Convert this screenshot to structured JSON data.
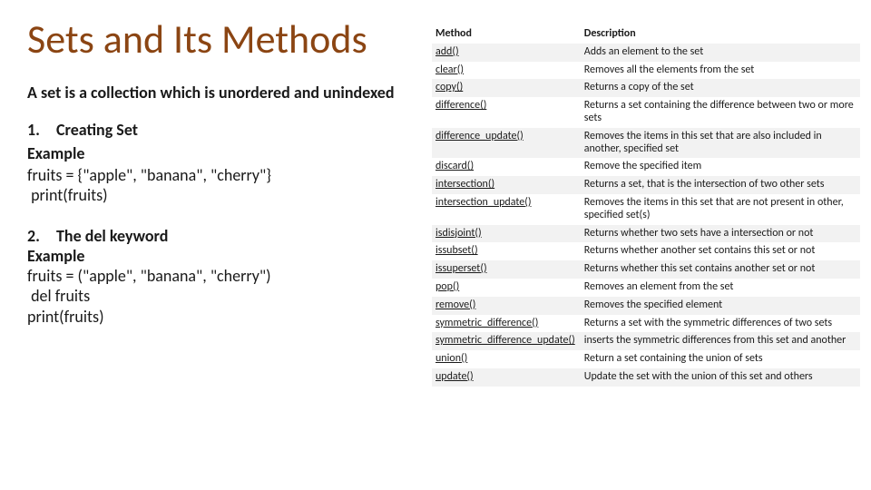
{
  "title": "Sets and Its Methods",
  "subtitle": "A set is a collection which is unordered and unindexed",
  "section1": {
    "num": "1.",
    "heading": "Creating Set",
    "example_label": "Example",
    "code": "fruits = {\"apple\", \"banana\", \"cherry\"}\n print(fruits)"
  },
  "section2": {
    "num": "2.",
    "heading": "The del keyword",
    "example_label": "Example",
    "code": "fruits = (\"apple\", \"banana\", \"cherry\")\n del fruits\nprint(fruits)"
  },
  "table": {
    "headers": {
      "method": "Method",
      "description": "Description"
    },
    "rows": [
      {
        "method": "add()",
        "description": "Adds an element to the set"
      },
      {
        "method": "clear()",
        "description": "Removes all the elements from the set"
      },
      {
        "method": "copy()",
        "description": "Returns a copy of the set"
      },
      {
        "method": "difference()",
        "description": "Returns a set containing the difference between two or more sets"
      },
      {
        "method": "difference_update()",
        "description": "Removes the items in this set that are also included in another, specified set"
      },
      {
        "method": "discard()",
        "description": "Remove the specified item"
      },
      {
        "method": "intersection()",
        "description": "Returns a set, that is the intersection of two other sets"
      },
      {
        "method": "intersection_update()",
        "description": "Removes the items in this set that are not present in other, specified set(s)"
      },
      {
        "method": "isdisjoint()",
        "description": "Returns whether two sets have a intersection or not"
      },
      {
        "method": "issubset()",
        "description": "Returns whether another set contains this set or not"
      },
      {
        "method": "issuperset()",
        "description": "Returns whether this set contains another set or not"
      },
      {
        "method": "pop()",
        "description": "Removes an element from the set"
      },
      {
        "method": "remove()",
        "description": "Removes the specified element"
      },
      {
        "method": "symmetric_difference()",
        "description": "Returns a set with the symmetric differences of two sets"
      },
      {
        "method": "symmetric_difference_update()",
        "description": "inserts the symmetric differences from this set and another"
      },
      {
        "method": "union()",
        "description": "Return a set containing the union of sets"
      },
      {
        "method": "update()",
        "description": "Update the set with the union of this set and others"
      }
    ]
  }
}
